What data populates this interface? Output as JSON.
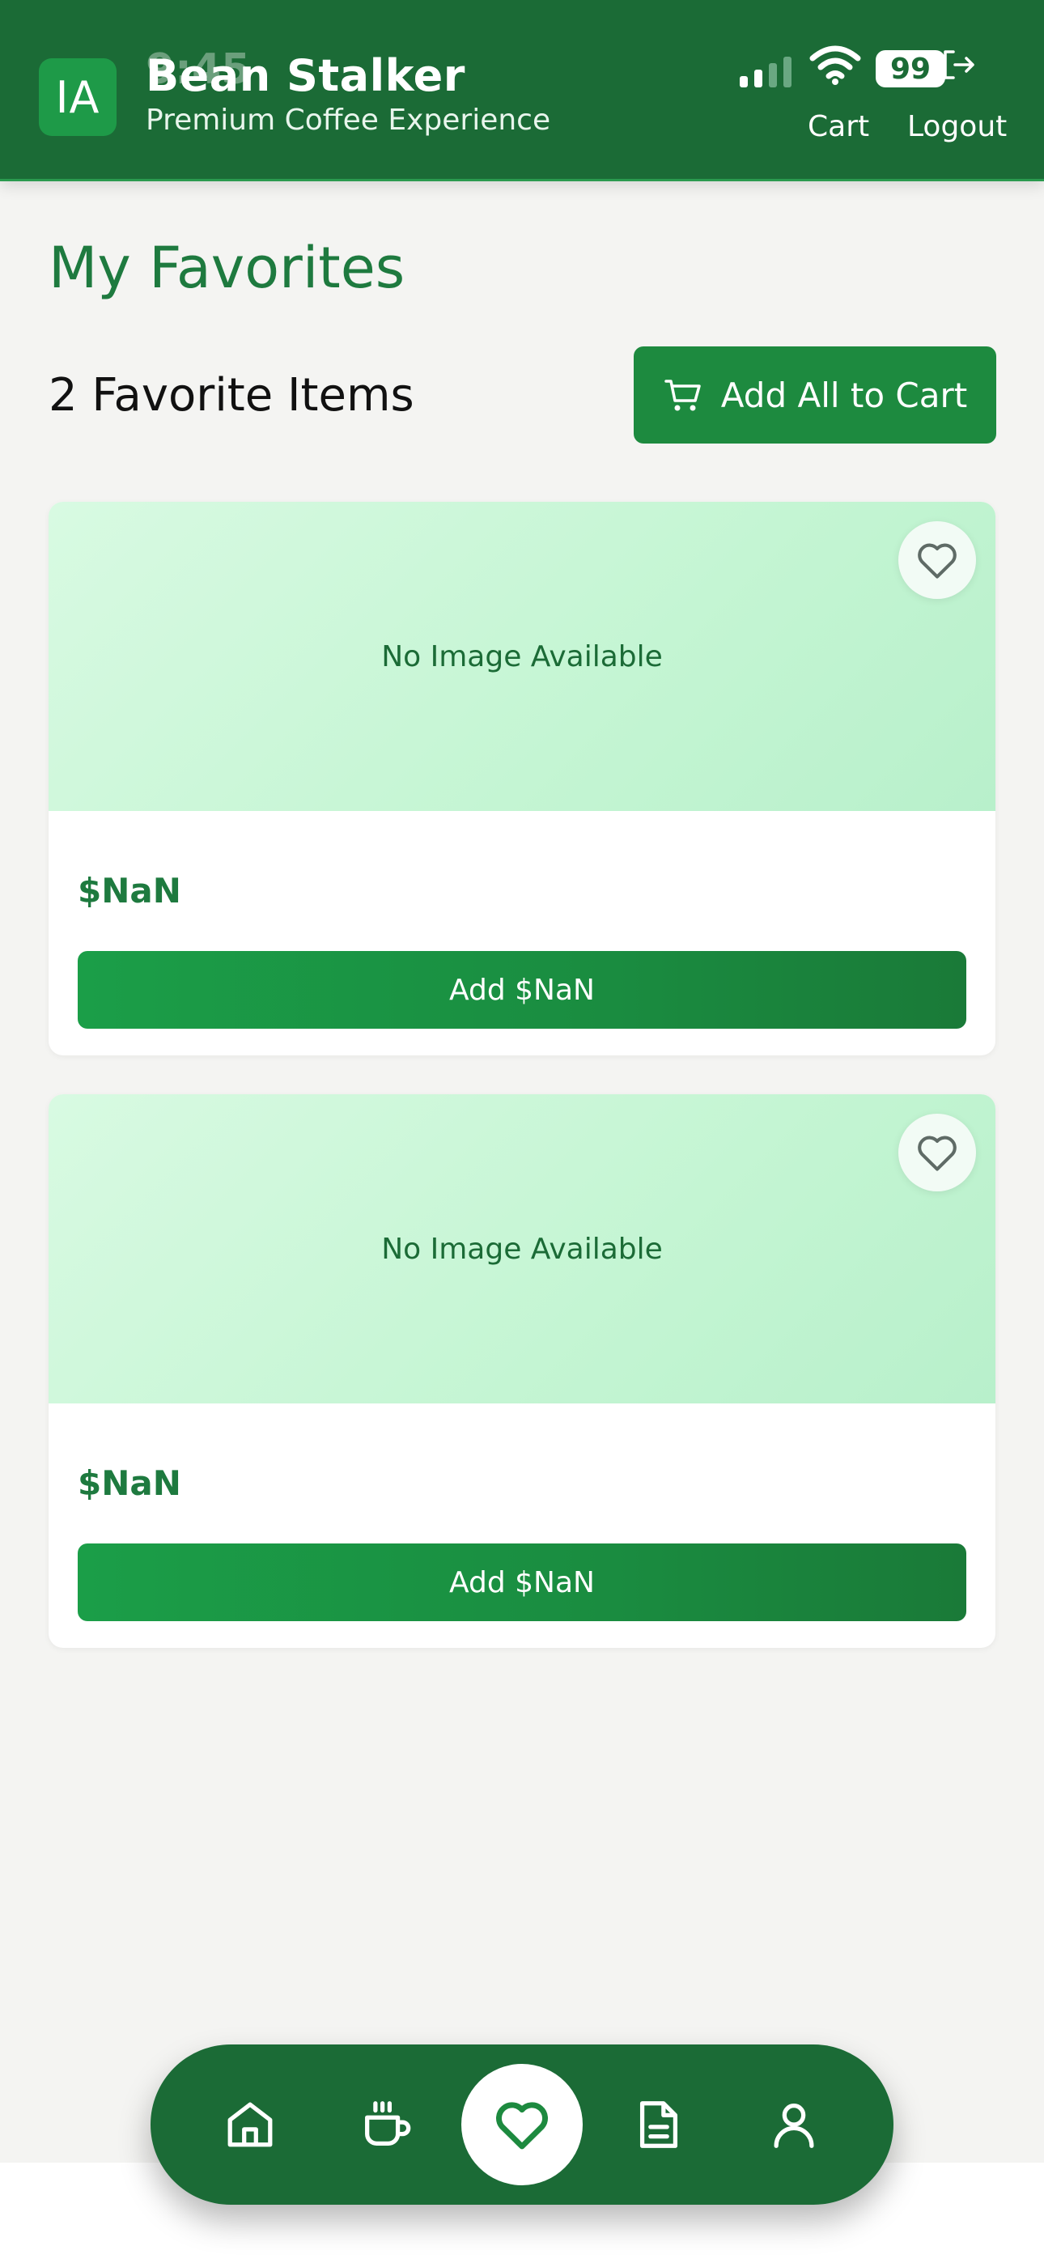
{
  "status_bar": {
    "time": "9:45",
    "battery": "99"
  },
  "header": {
    "logo_text": "IA",
    "title": "Bean Stalker",
    "subtitle": "Premium Coffee Experience",
    "nav": {
      "cart": "Cart",
      "logout": "Logout"
    }
  },
  "main": {
    "title": "My Favorites",
    "count_label": "2 Favorite Items",
    "add_all_label": "Add All to Cart",
    "items": [
      {
        "image_placeholder": "No Image Available",
        "price": "$NaN",
        "add_label": "Add $NaN"
      },
      {
        "image_placeholder": "No Image Available",
        "price": "$NaN",
        "add_label": "Add $NaN"
      }
    ]
  },
  "bottom_nav": {
    "items": [
      "home-icon",
      "coffee-cup-icon",
      "heart-icon",
      "document-icon",
      "user-icon"
    ],
    "active": "heart-icon"
  },
  "colors": {
    "header": "#1b6b36",
    "accent": "#1d8a3f",
    "title": "#1e7a3f",
    "image_bg": "#c4f5d3",
    "background": "#f4f4f2"
  }
}
